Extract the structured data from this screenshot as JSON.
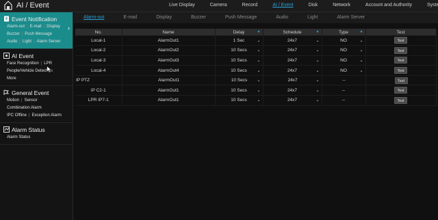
{
  "app": {
    "title": "AI / Event"
  },
  "topnav": [
    {
      "label": "Live Display",
      "active": false
    },
    {
      "label": "Camera",
      "active": false
    },
    {
      "label": "Record",
      "active": false
    },
    {
      "label": "AI / Event",
      "active": true
    },
    {
      "label": "Disk",
      "active": false
    },
    {
      "label": "Network",
      "active": false
    },
    {
      "label": "Account and Authority",
      "active": false
    },
    {
      "label": "System",
      "active": false
    }
  ],
  "sidebar": {
    "event_notification": {
      "title": "Event Notification",
      "row1": [
        "Alarm-out",
        "E-mail",
        "Display"
      ],
      "row2": [
        "Buzzer",
        "Push Message"
      ],
      "row3": [
        "Audio",
        "Light",
        "Alarm Server"
      ]
    },
    "ai_event": {
      "title": "AI Event",
      "row1": [
        "Face Recognition",
        "LPR"
      ],
      "row2": [
        "People/Vehicle Detection"
      ],
      "row3": [
        "More"
      ]
    },
    "general_event": {
      "title": "General Event",
      "row1": [
        "Motion",
        "Sensor"
      ],
      "row2": [
        "Combination Alarm"
      ],
      "row3": [
        "IPC Offline",
        "Exception Alarm"
      ]
    },
    "alarm_status": {
      "title": "Alarm Status",
      "row1": [
        "Alarm Status"
      ]
    }
  },
  "subtabs": [
    {
      "label": "Alarm-out",
      "active": true
    },
    {
      "label": "E-mail",
      "active": false
    },
    {
      "label": "Display",
      "active": false
    },
    {
      "label": "Buzzer",
      "active": false
    },
    {
      "label": "Push Message",
      "active": false
    },
    {
      "label": "Audio",
      "active": false
    },
    {
      "label": "Light",
      "active": false
    },
    {
      "label": "Alarm Server",
      "active": false
    }
  ],
  "table": {
    "headers": {
      "no": "No.",
      "name": "Name",
      "delay": "Delay",
      "schedule": "Schedule",
      "type": "Type",
      "test": "Test"
    },
    "test_label": "Test",
    "rows": [
      {
        "no": "Local-1",
        "name": "AlarmOut1",
        "delay": "1 Sec",
        "schedule": "24x7",
        "type": "NO"
      },
      {
        "no": "Local-2",
        "name": "AlarmOut2",
        "delay": "10 Secs",
        "schedule": "24x7",
        "type": "NO"
      },
      {
        "no": "Local-3",
        "name": "AlarmOut3",
        "delay": "10 Secs",
        "schedule": "24x7",
        "type": "NO"
      },
      {
        "no": "Local-4",
        "name": "AlarmOut4",
        "delay": "10 Secs",
        "schedule": "24x7",
        "type": "NO"
      },
      {
        "group": "IP PTZ",
        "name": "AlarmOut1",
        "delay": "10 Secs",
        "schedule": "24x7",
        "type": "--"
      },
      {
        "no": "IP C2-1",
        "name": "AlarmOut1",
        "delay": "10 Secs",
        "schedule": "24x7",
        "type": "--"
      },
      {
        "no": "LPR IP7-1",
        "name": "AlarmOut1",
        "delay": "10 Secs",
        "schedule": "24x7",
        "type": "--"
      }
    ]
  },
  "colors": {
    "accent": "#2aa3d9",
    "active_section": "#1a8c8c"
  }
}
